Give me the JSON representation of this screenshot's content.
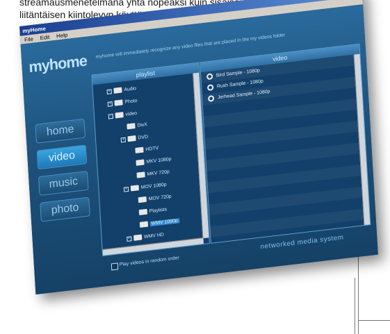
{
  "caption": {
    "line1": "streamausmenetelmänä yhtä nopeaksi kuin sisäisen tai USB-",
    "line2": "liitäntäisen kiintolevyn käyttö."
  },
  "window": {
    "title": "myHome",
    "controls": [
      "_",
      "□",
      "x"
    ]
  },
  "menu": [
    "File",
    "Edit",
    "Help"
  ],
  "app": {
    "logo": "myhome",
    "tagline": "myhome will immediately recognize any video files that are placed in the my videos folder",
    "nav": [
      "home",
      "video",
      "music",
      "photo"
    ],
    "active_nav": "video"
  },
  "playlist": {
    "header": "playlist",
    "tree": [
      {
        "label": "Audio",
        "expander": "+"
      },
      {
        "label": "Photo",
        "expander": "+"
      },
      {
        "label": "video",
        "expander": "-"
      },
      {
        "label": "DivX",
        "expander": ""
      },
      {
        "label": "DVD",
        "expander": "+"
      },
      {
        "label": "HDTV",
        "expander": ""
      },
      {
        "label": "MKV 1080p",
        "expander": ""
      },
      {
        "label": "MKV 720p",
        "expander": ""
      },
      {
        "label": "MOV 1080p",
        "expander": "+"
      },
      {
        "label": "MOV 720p",
        "expander": ""
      },
      {
        "label": "Playlists",
        "expander": ""
      },
      {
        "label": "WMV 1080p",
        "expander": "",
        "selected": true
      },
      {
        "label": "WMV HD",
        "expander": "+"
      }
    ]
  },
  "video_panel": {
    "header": "video",
    "items": [
      "Bird Sample - 1080p",
      "Rush Sample - 1080p",
      "Jerhead Sample - 1080p"
    ]
  },
  "random_option": "Play videos in random order",
  "footer_label": "networked media system"
}
